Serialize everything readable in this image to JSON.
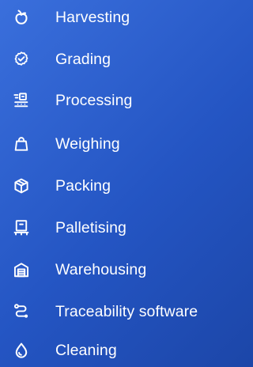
{
  "menu": {
    "items": [
      {
        "label": "Harvesting",
        "icon": "apple-icon"
      },
      {
        "label": "Grading",
        "icon": "badge-check-icon"
      },
      {
        "label": "Processing",
        "icon": "conveyor-icon"
      },
      {
        "label": "Weighing",
        "icon": "shopping-bag-icon"
      },
      {
        "label": "Packing",
        "icon": "box-icon"
      },
      {
        "label": "Palletising",
        "icon": "pallet-icon"
      },
      {
        "label": "Warehousing",
        "icon": "warehouse-icon"
      },
      {
        "label": "Traceability software",
        "icon": "route-icon"
      },
      {
        "label": "Cleaning",
        "icon": "droplet-icon"
      }
    ]
  }
}
